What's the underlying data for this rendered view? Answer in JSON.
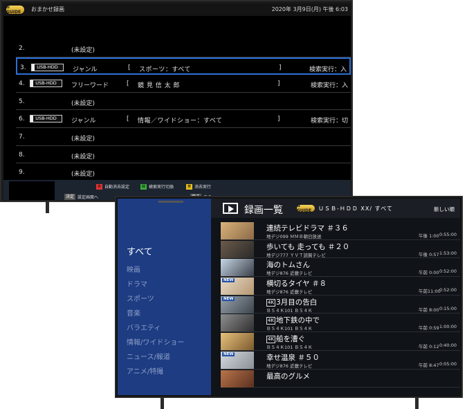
{
  "tv1": {
    "logo": "G GUIDE",
    "title": "おまかせ録画",
    "datetime": "2020年 3月9日(月) 午後 6:03",
    "rows": [
      {
        "num": "2.",
        "tag": "",
        "kind": "(未設定)",
        "condition": "",
        "exec": ""
      },
      {
        "num": "3.",
        "tag": "USB-HDD",
        "kind": "ジャンル",
        "condition": "スポーツ：すべて",
        "exec": "検索実行：入",
        "selected": true
      },
      {
        "num": "4.",
        "tag": "USB-HDD",
        "kind": "フリーワード",
        "condition": "鏡 見 信 太 郎",
        "exec": "検索実行：入"
      },
      {
        "num": "5.",
        "tag": "",
        "kind": "(未設定)",
        "condition": "",
        "exec": ""
      },
      {
        "num": "6.",
        "tag": "USB-HDD",
        "kind": "ジャンル",
        "condition": "情報／ワイドショー：すべて",
        "exec": "検索実行：切"
      },
      {
        "num": "7.",
        "tag": "",
        "kind": "(未設定)",
        "condition": "",
        "exec": ""
      },
      {
        "num": "8.",
        "tag": "",
        "kind": "(未設定)",
        "condition": "",
        "exec": ""
      },
      {
        "num": "9.",
        "tag": "",
        "kind": "(未設定)",
        "condition": "",
        "exec": ""
      }
    ],
    "bracket_left": "[",
    "bracket_right": "]",
    "legend": [
      {
        "key": "赤",
        "label": "自動消去設定",
        "color": "#e03434"
      },
      {
        "key": "緑",
        "label": "検索実行切換",
        "color": "#3cae3c"
      },
      {
        "key": "黄",
        "label": "消去実行",
        "color": "#e8c020"
      }
    ],
    "enter_key": "決定",
    "enter_label": "設定画面へ",
    "back_key": "戻る",
    "back_label": "戻る"
  },
  "tv2": {
    "header": {
      "title": "録画一覧",
      "logo": "G GUIDE",
      "path": "ＵＳＢ-ＨＤＤ XX/ すべて",
      "sort": "新しい順"
    },
    "sidebar": [
      {
        "label": "すべて",
        "active": true
      },
      {
        "label": "映画"
      },
      {
        "label": "ドラマ"
      },
      {
        "label": "スポーツ"
      },
      {
        "label": "音楽"
      },
      {
        "label": "バラエティ"
      },
      {
        "label": "情報/ワイドショー"
      },
      {
        "label": "ニュース/報道"
      },
      {
        "label": "アニメ/特撮"
      }
    ],
    "recordings": [
      {
        "title": "連続テレビドラマ ＃３６",
        "badge": "",
        "channel": "地デジ099 ＭＭＢ朝日放送",
        "time": "午後 1:00",
        "duration": "0:55:00",
        "new": false,
        "thumb": [
          "#d9b27a",
          "#8c6a48"
        ]
      },
      {
        "title": "歩いても 走っても ＃２０",
        "badge": "",
        "channel": "地デジ777 ＹＶＴ読賀テレビ",
        "time": "午後 0:57",
        "duration": "1:53:00",
        "new": false,
        "thumb": [
          "#6b5a4a",
          "#2a2a2a"
        ]
      },
      {
        "title": "海のトムさん",
        "badge": "",
        "channel": "地デジ876 近畿テレビ",
        "time": "午前 0:00",
        "duration": "0:52:00",
        "new": false,
        "thumb": [
          "#c7d6e6",
          "#3a3f48"
        ]
      },
      {
        "title": "横切るタイヤ ＃８",
        "badge": "",
        "channel": "地デジ876 近畿テレビ",
        "time": "午前11:00",
        "duration": "0:52:00",
        "new": true,
        "new_label": "NEW",
        "thumb": [
          "#e8dcc8",
          "#b59672"
        ]
      },
      {
        "title": "3月目の告白",
        "badge": "4K",
        "channel": "ＢＳ４Ｋ101 ＢＳ４Ｋ",
        "time": "午前 8:00",
        "duration": "0:15:00",
        "new": true,
        "new_label": "NEW",
        "thumb": [
          "#9aa4ad",
          "#3c444c"
        ]
      },
      {
        "title": "地下鉄の中で",
        "badge": "4K",
        "channel": "ＢＳ４Ｋ101 ＢＳ４Ｋ",
        "time": "午前 0:59",
        "duration": "1:00:00",
        "new": false,
        "thumb": [
          "#8e8e8e",
          "#2f2f2f"
        ]
      },
      {
        "title": "船を漕ぐ",
        "badge": "4K",
        "channel": "ＢＳ４Ｋ101 ＢＳ４Ｋ",
        "time": "午前 0:12",
        "duration": "0:40:00",
        "new": false,
        "thumb": [
          "#e7c27d",
          "#7b5a2d"
        ]
      },
      {
        "title": "幸せ温泉 ＃５０",
        "badge": "",
        "channel": "地デジ876 近畿テレビ",
        "time": "午前 8:47",
        "duration": "0:05:00",
        "new": true,
        "new_label": "NEW",
        "thumb": [
          "#d6dbe0",
          "#8a8f96"
        ]
      },
      {
        "title": "最高のグルメ",
        "badge": "",
        "channel": "",
        "time": "",
        "duration": "",
        "new": false,
        "thumb": [
          "#b9744a",
          "#5a3020"
        ]
      }
    ]
  }
}
